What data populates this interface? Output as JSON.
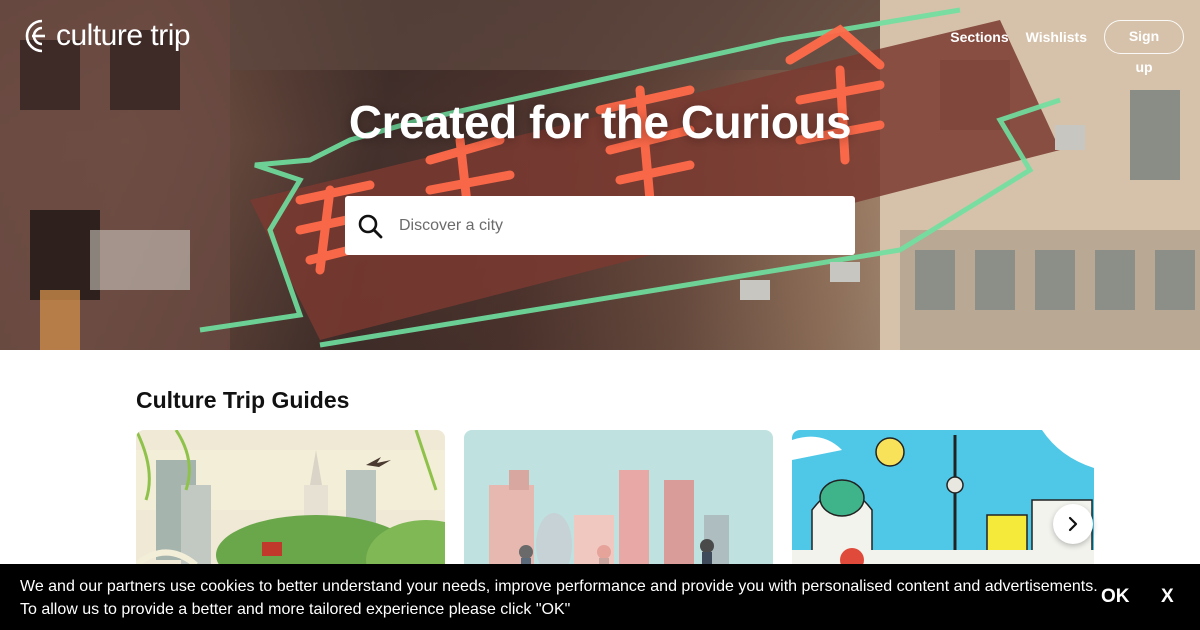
{
  "header": {
    "brand": "culture trip",
    "nav": [
      "Sections",
      "Wishlists"
    ],
    "signup_label": "Sign up"
  },
  "hero": {
    "title": "Created for the Curious",
    "search_placeholder": "Discover a city"
  },
  "guides": {
    "title": "Culture Trip Guides",
    "cards": [
      {
        "icon": "beijing-illustration"
      },
      {
        "icon": "london-illustration"
      },
      {
        "icon": "berlin-illustration"
      }
    ]
  },
  "cookie_banner": {
    "line1": "We and our partners use cookies to better understand your needs, improve performance and provide you with personalised content and advertisements.",
    "line2": "To allow us to provide a better and more tailored experience please click \"OK\"",
    "ok_label": "OK",
    "close_label": "X"
  },
  "colors": {
    "neon_red": "#ff6a4a",
    "neon_green": "#6fe0a0",
    "cookie_bg": "#000000"
  }
}
